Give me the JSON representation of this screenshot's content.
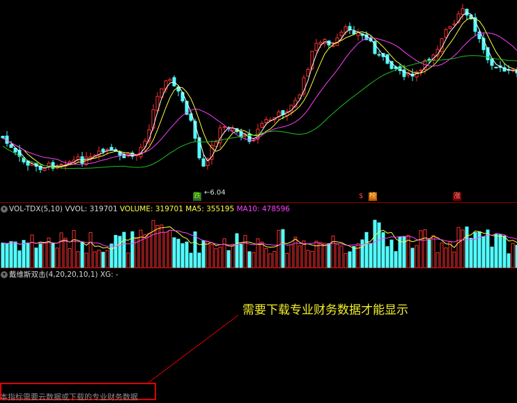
{
  "kline": {
    "low_marker": "6.04",
    "tags": [
      {
        "text": "跌",
        "bg": "#2f6a2f",
        "color": "#7cfc00"
      },
      {
        "text": "$",
        "bg": "#000",
        "color": "#ff4040"
      },
      {
        "text": "榜",
        "bg": "#c85a00",
        "color": "#ffe060"
      },
      {
        "text": "涨",
        "bg": "#7a0000",
        "color": "#ff8080"
      }
    ]
  },
  "vol_panel": {
    "name": "VOL-TDX(5,10)",
    "vvol": "VVOL: 319701",
    "volume": "VOLUME: 319701",
    "ma5": "MA5: 355195",
    "ma10": "MA10: 478596"
  },
  "indicator_panel": {
    "name": "戴维斯双击(4,20,20,10,1)",
    "xg": "XG: -"
  },
  "annotation": "需要下载专业财务数据才能显示",
  "footer_note": "本指标需要云数据或下载的专业财务数据",
  "colors": {
    "up": "#ff3030",
    "down": "#54ffff",
    "ma_white": "#ffffff",
    "ma_yellow": "#ffff40",
    "ma_magenta": "#ff40ff",
    "ma_green": "#20c020",
    "vol_ma5": "#ffff40",
    "vol_ma10": "#ff40ff",
    "annotation": "#f2ee2a"
  },
  "chart_data": {
    "type": "candlestick",
    "price_low": 6.04,
    "candles_count": 124
  }
}
